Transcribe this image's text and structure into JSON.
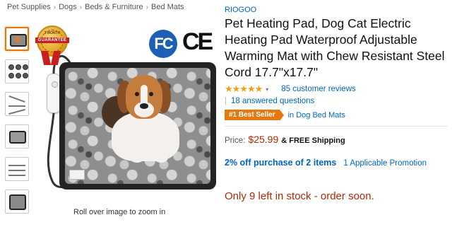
{
  "breadcrumb": [
    "Pet Supplies",
    "Dogs",
    "Beds & Furniture",
    "Bed Mats"
  ],
  "breadcrumb_separator": "›",
  "image": {
    "badge_top": "3 MONTH",
    "badge_text": "GUARANTEE",
    "fc_mark": "FC",
    "ce_mark": "CE",
    "zoom_hint": "Roll over image to zoom in"
  },
  "product": {
    "brand": "RIOGOO",
    "title": "Pet Heating Pad, Dog Cat Electric Heating Pad Waterproof Adjustable Warming Mat with Chew Resistant Steel Cord 17.7\"x17.7\"",
    "stars": "★★★★★",
    "rating_caret": "▾",
    "reviews": "85 customer reviews",
    "answered_sep": "|",
    "answered": "18 answered questions",
    "bestseller_badge": "#1 Best Seller",
    "bestseller_category": "in Dog Bed Mats",
    "price_label": "Price:",
    "price": "$25.99",
    "shipping": "& FREE Shipping",
    "promo": "2% off purchase of 2 items",
    "promo_link": "1 Applicable Promotion",
    "stock": "Only 9 left in stock - order soon."
  },
  "colors": {
    "link": "#0066c0",
    "price": "#b12704",
    "bestseller": "#e47911",
    "star": "#f0a012"
  }
}
